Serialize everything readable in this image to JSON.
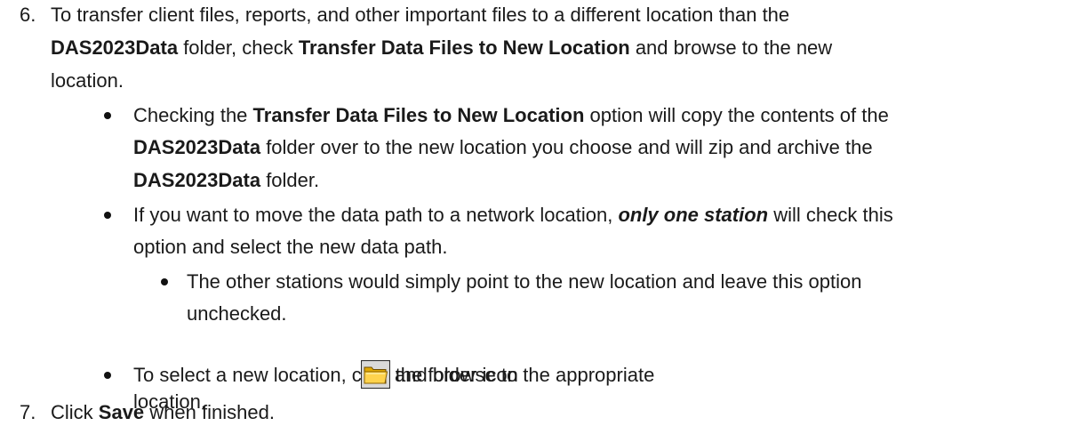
{
  "step6": {
    "number": "6.",
    "l1_a": "To transfer client files, reports, and other important files to a different location than the",
    "l2_b1": "DAS2023Data",
    "l2_a": " folder, check ",
    "l2_b2": "Transfer Data Files to New Location",
    "l2_c": " and browse to the new",
    "l3": "location."
  },
  "bullet1": {
    "l1_a": "Checking the ",
    "l1_b": "Transfer Data Files to New Location",
    "l1_c": " option will copy the contents of the",
    "l2_b": "DAS2023Data",
    "l2_a": " folder over to the new location you choose and will zip and archive the",
    "l3_b": "DAS2023Data",
    "l3_a": " folder."
  },
  "bullet2": {
    "l1_a": "If you want to move the data path to a network location, ",
    "l1_bi": "only one station",
    "l1_c": " will check this",
    "l2": "option and select the new data path."
  },
  "sub_bullet": {
    "l1": "The other stations would simply point to the new location and leave this option",
    "l2": "unchecked."
  },
  "bullet3": {
    "l1_a": "To select a new location, click the folder icon ",
    "icon": "folder-icon",
    "l1_b": " and browse to the appropriate",
    "l2": "location."
  },
  "step7": {
    "number": "7.",
    "a": "Click ",
    "b": "Save",
    "c": " when finished."
  }
}
